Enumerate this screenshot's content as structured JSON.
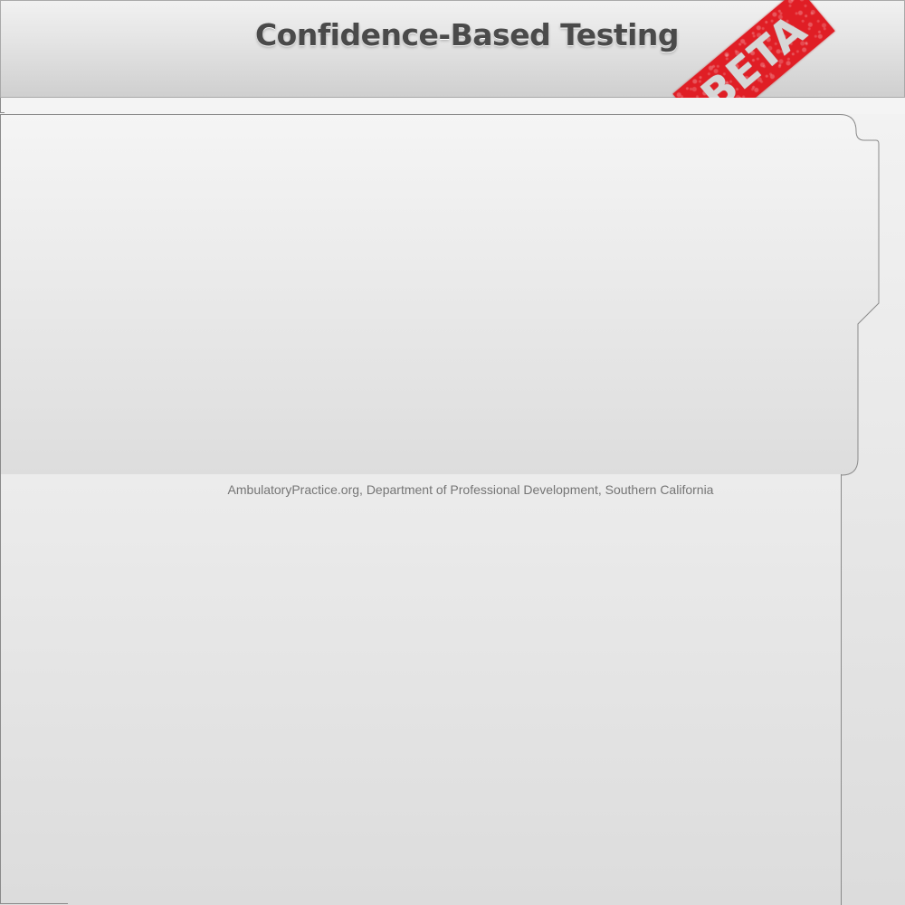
{
  "header": {
    "title": "Confidence-Based Testing",
    "badge": "BETA",
    "badge_color": "#e01e25"
  },
  "panel": {
    "content": ""
  },
  "footer": {
    "text": "AmbulatoryPractice.org, Department of Professional Development, Southern California"
  },
  "colors": {
    "background": "#e6e6e6",
    "border": "#8a8a8a",
    "title": "#4a4a4a",
    "footer_text": "#757575"
  }
}
